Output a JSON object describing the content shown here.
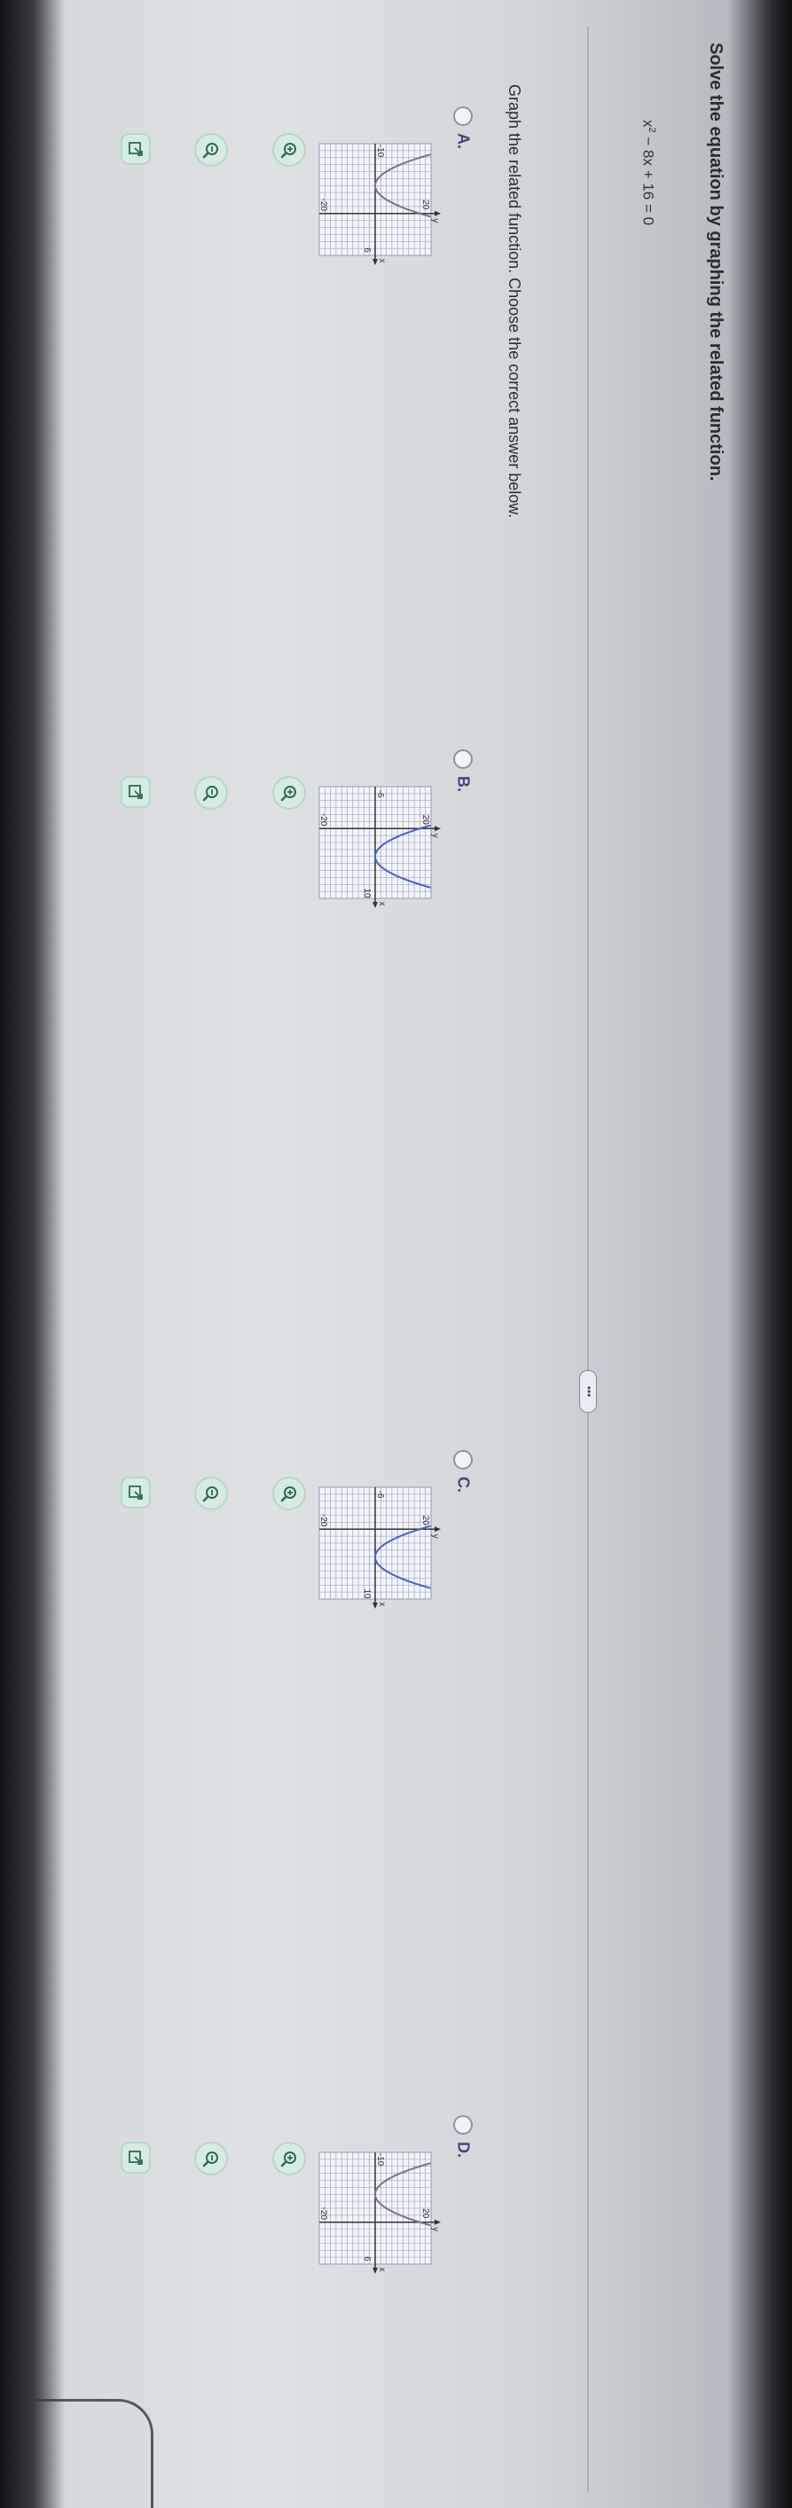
{
  "question": {
    "title": "Solve the equation by graphing the related function.",
    "equation_base": "x",
    "equation_exp": "2",
    "equation_rest": " − 8x + 16 = 0",
    "more_label": "•••",
    "instruction": "Graph the related function. Choose the correct answer below."
  },
  "options": [
    {
      "id": "a",
      "letter": "A.",
      "selected": false,
      "x_labels": [
        "-10",
        "6"
      ],
      "y_labels": [
        "20",
        "-20"
      ],
      "axis_x": "x",
      "axis_y": "y",
      "vertex": [
        -4,
        0
      ]
    },
    {
      "id": "b",
      "letter": "B.",
      "selected": false,
      "x_labels": [
        "-6",
        "10"
      ],
      "y_labels": [
        "20",
        "-20"
      ],
      "axis_x": "x",
      "axis_y": "y",
      "vertex": [
        4,
        0
      ]
    },
    {
      "id": "c",
      "letter": "C.",
      "selected": false,
      "x_labels": [
        "-6",
        "10"
      ],
      "y_labels": [
        "20",
        "-20"
      ],
      "axis_x": "x",
      "axis_y": "y",
      "vertex": [
        4,
        0
      ]
    },
    {
      "id": "d",
      "letter": "D.",
      "selected": false,
      "x_labels": [
        "-10",
        "6"
      ],
      "y_labels": [
        "20",
        "-20"
      ],
      "axis_x": "x",
      "axis_y": "y",
      "vertex": [
        -4,
        0
      ]
    }
  ],
  "graph_style": {
    "curve_color_blue": "#4a62c4",
    "curve_color_gray": "#7a7480",
    "grid_color": "#8f9aba",
    "axis_color": "#333333"
  },
  "tools": [
    "zoom-in-icon",
    "zoom-out-icon",
    "expand-icon"
  ]
}
